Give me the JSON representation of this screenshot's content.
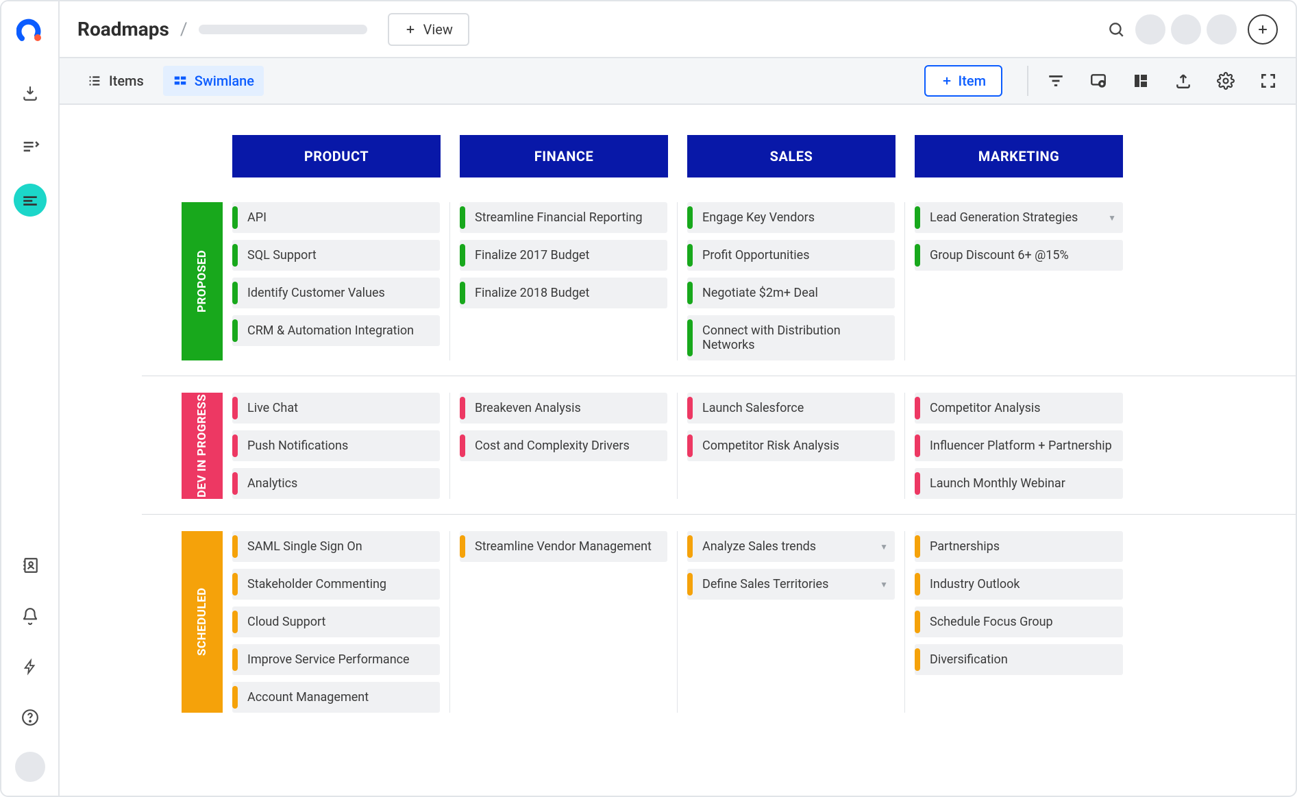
{
  "page": {
    "title": "Roadmaps"
  },
  "topbar": {
    "view_button": "View",
    "add_button_plus": "+"
  },
  "subbar": {
    "items_toggle": "Items",
    "swimlane_toggle": "Swimlane",
    "add_item": "Item"
  },
  "columns": [
    "PRODUCT",
    "FINANCE",
    "SALES",
    "MARKETING"
  ],
  "lanes": [
    {
      "id": "proposed",
      "label": "PROPOSED",
      "color": "green",
      "cells": [
        [
          "API",
          "SQL Support",
          "Identify Customer Values",
          "CRM & Automation Integration"
        ],
        [
          "Streamline Financial Reporting",
          "Finalize 2017 Budget",
          "Finalize 2018 Budget"
        ],
        [
          "Engage Key Vendors",
          "Profit Opportunities",
          "Negotiate $2m+ Deal",
          "Connect with Distribution Networks"
        ],
        [
          "Lead Generation Strategies",
          "Group Discount 6+ @15%"
        ]
      ],
      "chevrons": [
        [],
        [],
        [],
        [
          0
        ]
      ]
    },
    {
      "id": "dev-in-progress",
      "label": "DEV IN PROGRESS",
      "color": "pink",
      "cells": [
        [
          "Live Chat",
          "Push Notifications",
          "Analytics"
        ],
        [
          "Breakeven Analysis",
          "Cost and Complexity Drivers"
        ],
        [
          "Launch Salesforce",
          "Competitor Risk Analysis"
        ],
        [
          "Competitor Analysis",
          "Influencer Platform + Partnership",
          "Launch Monthly Webinar"
        ]
      ],
      "chevrons": [
        [],
        [],
        [],
        []
      ]
    },
    {
      "id": "scheduled",
      "label": "SCHEDULED",
      "color": "orange",
      "cells": [
        [
          "SAML Single Sign On",
          "Stakeholder Commenting",
          "Cloud Support",
          "Improve Service Performance",
          "Account Management"
        ],
        [
          "Streamline Vendor Management"
        ],
        [
          "Analyze Sales trends",
          "Define Sales Territories"
        ],
        [
          "Partnerships",
          "Industry Outlook",
          "Schedule Focus Group",
          "Diversification"
        ]
      ],
      "chevrons": [
        [],
        [],
        [
          0,
          1
        ],
        []
      ]
    }
  ]
}
